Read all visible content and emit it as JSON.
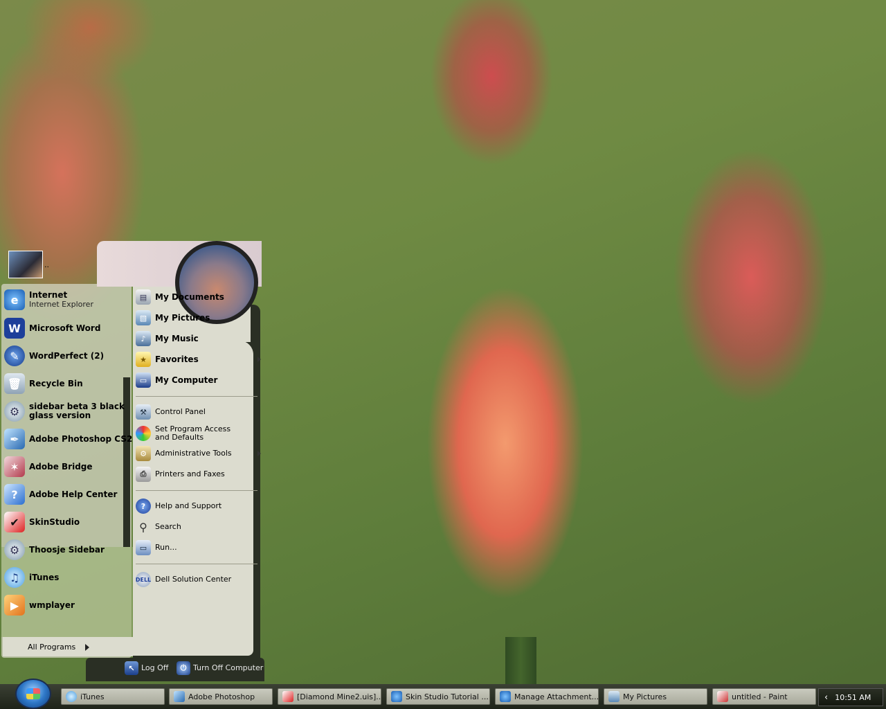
{
  "user": {
    "name": ".."
  },
  "left_pinned": [
    {
      "label": "Internet",
      "sub": "Internet Explorer",
      "icon": "internet-explorer-icon"
    },
    {
      "label": "Microsoft Word",
      "icon": "word-icon"
    },
    {
      "label": "WordPerfect (2)",
      "icon": "wordperfect-icon"
    }
  ],
  "left_recent": [
    {
      "label": "Recycle Bin",
      "icon": "recycle-bin-icon"
    },
    {
      "label": "sidebar beta 3 black glass version",
      "icon": "gear-icon"
    },
    {
      "label": "Adobe Photoshop CS2",
      "icon": "photoshop-icon"
    },
    {
      "label": "Adobe Bridge",
      "icon": "bridge-icon"
    },
    {
      "label": "Adobe Help Center",
      "icon": "help-center-icon"
    },
    {
      "label": "SkinStudio",
      "icon": "skinstudio-icon"
    },
    {
      "label": "Thoosje Sidebar",
      "icon": "gear-icon"
    },
    {
      "label": "iTunes",
      "icon": "itunes-icon"
    },
    {
      "label": "wmplayer",
      "icon": "media-player-icon"
    }
  ],
  "all_programs": "All Programs",
  "right_places": [
    {
      "label": "My Documents",
      "icon": "documents-icon"
    },
    {
      "label": "My Pictures",
      "icon": "pictures-icon"
    },
    {
      "label": "My Music",
      "icon": "music-icon"
    },
    {
      "label": "Favorites",
      "icon": "favorites-icon"
    },
    {
      "label": "My Computer",
      "icon": "computer-icon"
    }
  ],
  "right_settings": [
    {
      "label": "Control Panel",
      "icon": "control-panel-icon"
    },
    {
      "label": "Set Program Access and Defaults",
      "icon": "program-access-icon"
    },
    {
      "label": "Administrative Tools",
      "icon": "admin-tools-icon"
    },
    {
      "label": "Printers and Faxes",
      "icon": "printer-icon"
    }
  ],
  "right_tools": [
    {
      "label": "Help and Support",
      "icon": "help-icon"
    },
    {
      "label": "Search",
      "icon": "search-icon"
    },
    {
      "label": "Run...",
      "icon": "run-icon"
    }
  ],
  "right_oem": [
    {
      "label": "Dell Solution Center",
      "icon": "dell-icon"
    }
  ],
  "footer": {
    "log_off": "Log Off",
    "turn_off": "Turn Off Computer"
  },
  "taskbar": [
    {
      "label": "iTunes"
    },
    {
      "label": "Adobe Photoshop"
    },
    {
      "label": "[Diamond Mine2.uis]..."
    },
    {
      "label": "Skin Studio Tutorial ..."
    },
    {
      "label": "Manage Attachment..."
    },
    {
      "label": "My Pictures"
    },
    {
      "label": "untitled - Paint"
    }
  ],
  "clock": "10:51 AM",
  "colors": {
    "taskbar": "#1e2319",
    "menu_panel": "#dcdccf",
    "start_orb": "#2f78c8"
  }
}
